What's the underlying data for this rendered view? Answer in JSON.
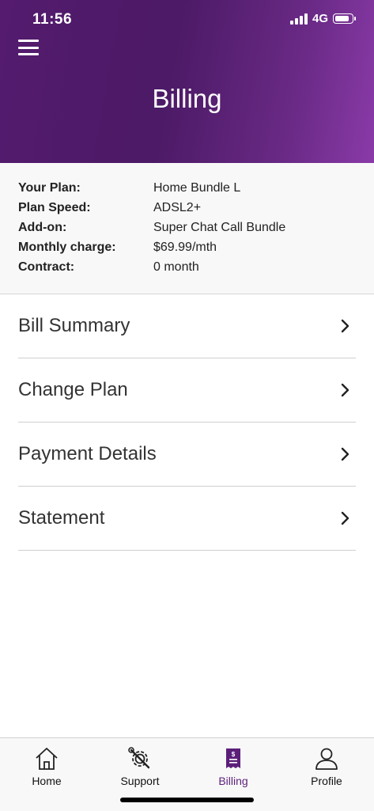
{
  "status_bar": {
    "time": "11:56",
    "network": "4G",
    "battery_level": 0.85
  },
  "header": {
    "title": "Billing",
    "menu_icon": "hamburger-menu-icon"
  },
  "plan": {
    "rows": [
      {
        "label": "Your Plan:",
        "value": "Home Bundle L"
      },
      {
        "label": "Plan Speed:",
        "value": "ADSL2+"
      },
      {
        "label": "Add-on:",
        "value": "Super Chat Call Bundle"
      },
      {
        "label": "Monthly charge:",
        "value": "$69.99/mth"
      },
      {
        "label": "Contract:",
        "value": "0 month"
      }
    ]
  },
  "menu": {
    "items": [
      {
        "label": "Bill Summary",
        "icon": "chevron-right-icon"
      },
      {
        "label": "Change Plan",
        "icon": "chevron-right-icon"
      },
      {
        "label": "Payment Details",
        "icon": "chevron-right-icon"
      },
      {
        "label": "Statement",
        "icon": "chevron-right-icon"
      }
    ]
  },
  "tabbar": {
    "active": "Billing",
    "accent_color": "#5b1f7a",
    "tabs": [
      {
        "label": "Home",
        "icon": "home-icon"
      },
      {
        "label": "Support",
        "icon": "gear-wrench-icon"
      },
      {
        "label": "Billing",
        "icon": "bill-receipt-icon"
      },
      {
        "label": "Profile",
        "icon": "person-icon"
      }
    ]
  },
  "colors": {
    "header_start": "#541b6e",
    "header_end": "#8a3aa8"
  }
}
